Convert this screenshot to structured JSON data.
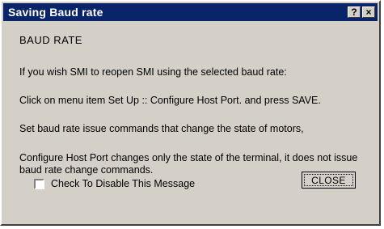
{
  "window": {
    "title": "Saving Baud rate",
    "help_glyph": "?",
    "close_glyph": "×"
  },
  "message": {
    "heading": "BAUD RATE",
    "line1": "If you wish SMI to reopen SMI using the selected baud rate:",
    "line2": "Click on menu item  Set Up :: Configure Host Port. and press SAVE.",
    "line3": "Set baud rate issue commands that change the state of motors,",
    "line4": "Configure Host Port changes only the state of the terminal, it does not issue baud rate change commands."
  },
  "checkbox": {
    "label": "Check To Disable This Message",
    "checked": false
  },
  "buttons": {
    "close_label": "CLOSE"
  },
  "colors": {
    "titlebar": "#0a246a",
    "face": "#d4d0c8"
  }
}
